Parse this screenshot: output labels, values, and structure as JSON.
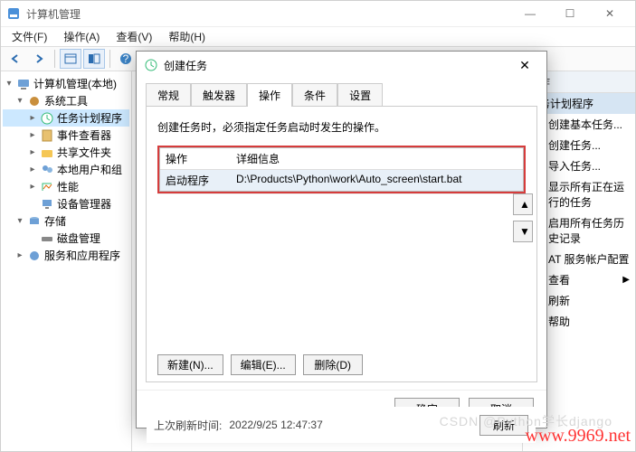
{
  "window": {
    "title": "计算机管理",
    "controls": {
      "min": "—",
      "max": "☐",
      "close": "✕"
    }
  },
  "menu": {
    "file": "文件(F)",
    "action": "操作(A)",
    "view": "查看(V)",
    "help": "帮助(H)"
  },
  "tree": {
    "root": "计算机管理(本地)",
    "system_tools": "系统工具",
    "task_scheduler": "任务计划程序",
    "event_viewer": "事件查看器",
    "shared_folders": "共享文件夹",
    "local_users": "本地用户和组",
    "performance": "性能",
    "device_manager": "设备管理器",
    "storage": "存储",
    "disk_mgmt": "磁盘管理",
    "services_apps": "服务和应用程序"
  },
  "actions": {
    "header": "操作",
    "title": "任务计划程序",
    "items": [
      "创建基本任务...",
      "创建任务...",
      "导入任务...",
      "显示所有正在运行的任务",
      "启用所有任务历史记录",
      "AT 服务帐户配置",
      "查看",
      "刷新",
      "帮助"
    ]
  },
  "dialog": {
    "title": "创建任务",
    "tabs": {
      "general": "常规",
      "triggers": "触发器",
      "actions": "操作",
      "conditions": "条件",
      "settings": "设置"
    },
    "note": "创建任务时，必须指定任务启动时发生的操作。",
    "grid": {
      "col_action": "操作",
      "col_detail": "详细信息",
      "row_action": "启动程序",
      "row_detail": "D:\\Products\\Python\\work\\Auto_screen\\start.bat"
    },
    "move_up": "▲",
    "move_down": "▼",
    "buttons": {
      "new": "新建(N)...",
      "edit": "编辑(E)...",
      "delete": "删除(D)"
    },
    "ok": "确定",
    "cancel": "取消"
  },
  "status": {
    "last_refresh_label": "上次刷新时间:",
    "last_refresh_value": "2022/9/25 12:47:37",
    "refresh_btn": "刷新"
  },
  "watermark": {
    "csdn": "CSDN @Python学长django",
    "url": "www.9969.net"
  }
}
